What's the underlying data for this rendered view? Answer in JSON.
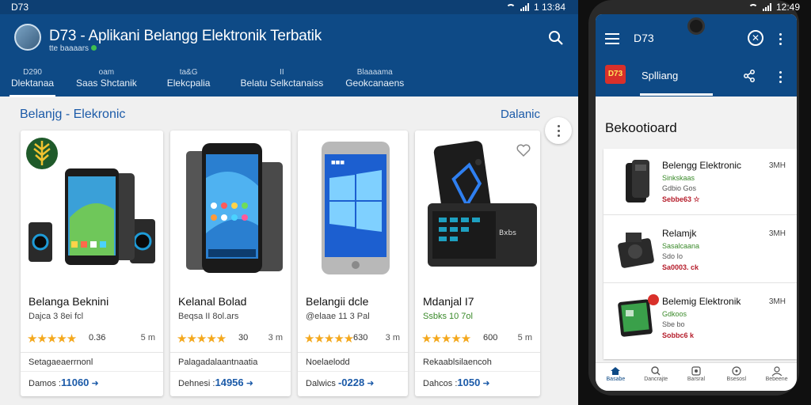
{
  "statusbar": {
    "carrier": "D73",
    "time": "1 13:84"
  },
  "phone_status": {
    "time": "12:49"
  },
  "appbar": {
    "title": "D73 - Aplikani Belangg Elektronik Terbatik",
    "subtitle": "tte baaaars"
  },
  "tabs": [
    {
      "top": "D290",
      "bottom": "Dlektanaa"
    },
    {
      "top": "oam",
      "bottom": "Saas Shctanik"
    },
    {
      "top": "ta&G",
      "bottom": "Elekcpalia"
    },
    {
      "top": "II",
      "bottom": "Belatu Selkctanaiss"
    },
    {
      "top": "Blaaaama",
      "bottom": "Geokcanaens"
    }
  ],
  "section": {
    "title": "Belanjg - Elekronic",
    "right": "Dalanic"
  },
  "products": [
    {
      "name": "Belanga Beknini",
      "meta": "Dajca 3 8ei fcl",
      "rating": "0.36",
      "unit": "5 m",
      "category": "Setagaeaerrnonl",
      "price_label": "Damos",
      "price": "11060",
      "ship": "➜"
    },
    {
      "name": "Kelanal Bolad",
      "meta": "Beqsa II 8ol.ars",
      "rating": "30",
      "unit": "3 m",
      "category": "Palagadalaantnaatia",
      "price_label": "Dehnesi",
      "price": "14956",
      "ship": "➜"
    },
    {
      "name": "Belangii dcle",
      "meta": "@elaae 11 3 Pal",
      "rating": "630",
      "unit": "3 m",
      "category": "Noelaelodd",
      "price_label": "Dalwics",
      "price": "-0228",
      "ship": "➜"
    },
    {
      "name": "Mdanjal I7",
      "meta": "Ssbks 10 7ol",
      "rating": "600",
      "unit": "5 m",
      "category": "Rekaablsilaencoh",
      "price_label": "Dahcos",
      "price": "1050",
      "ship": "➜"
    }
  ],
  "phone": {
    "title": "D73",
    "logo_text": "D73",
    "tab": "Splliang",
    "heading": "Bekootioard",
    "items": [
      {
        "name": "Belengg Elektronic",
        "meta": "Sinkskaas",
        "meta2": "Gdbio Gos",
        "price": "Sebbe63 ☆",
        "unit": "3MH"
      },
      {
        "name": "Relamjk",
        "meta": "Sasalcaana",
        "meta2": "Sdo Io",
        "price": "Sa0003. ck",
        "unit": "3MH"
      },
      {
        "name": "Belemig Elektronik",
        "meta": "Gdkoos",
        "meta2": "Sbe bo",
        "price": "Sobbc6 k",
        "unit": "3MH"
      }
    ],
    "nav": [
      "Basabe",
      "Dancrajte",
      "Barsral",
      "Bsesosl",
      "Bebeene"
    ]
  },
  "colors": {
    "primary": "#0e4a86",
    "accent": "#1b5aa8",
    "star": "#f4a81d",
    "price_red": "#b51d2b"
  }
}
